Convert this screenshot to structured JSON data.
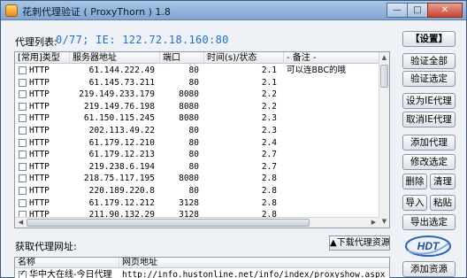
{
  "window": {
    "title": "花刺代理验证 ( ProxyThorn ) 1.8",
    "controls": {
      "minimize": "—",
      "maximize": "□",
      "close": "✕"
    }
  },
  "proxy_list": {
    "label": "代理列表:",
    "status": "0/77;   IE: 122.72.18.160:80",
    "columns": [
      "[常用]类型",
      "服务器地址",
      "端口",
      "时间(s)/状态",
      "- 备注 -"
    ],
    "rows": [
      {
        "type": "HTTP",
        "address": "61.144.222.49",
        "port": "80",
        "state": "2.1",
        "note": "可以连BBC的哦"
      },
      {
        "type": "HTTP",
        "address": "61.145.73.211",
        "port": "80",
        "state": "2.1",
        "note": ""
      },
      {
        "type": "HTTP",
        "address": "219.149.233.179",
        "port": "8080",
        "state": "2.2",
        "note": ""
      },
      {
        "type": "HTTP",
        "address": "219.149.76.198",
        "port": "8080",
        "state": "2.2",
        "note": ""
      },
      {
        "type": "HTTP",
        "address": "61.150.115.245",
        "port": "8080",
        "state": "2.3",
        "note": ""
      },
      {
        "type": "HTTP",
        "address": "202.113.49.22",
        "port": "80",
        "state": "2.3",
        "note": ""
      },
      {
        "type": "HTTP",
        "address": "61.179.12.210",
        "port": "80",
        "state": "2.4",
        "note": ""
      },
      {
        "type": "HTTP",
        "address": "61.179.12.213",
        "port": "80",
        "state": "2.7",
        "note": ""
      },
      {
        "type": "HTTP",
        "address": "219.238.6.194",
        "port": "80",
        "state": "2.7",
        "note": ""
      },
      {
        "type": "HTTP",
        "address": "218.75.117.195",
        "port": "8080",
        "state": "2.8",
        "note": ""
      },
      {
        "type": "HTTP",
        "address": "220.189.220.8",
        "port": "80",
        "state": "2.8",
        "note": ""
      },
      {
        "type": "HTTP",
        "address": "61.179.12.212",
        "port": "3128",
        "state": "2.8",
        "note": ""
      },
      {
        "type": "HTTP",
        "address": "211.90.132.29",
        "port": "3128",
        "state": "2.8",
        "note": ""
      }
    ]
  },
  "buttons": {
    "settings": "【设置】",
    "verify_all": "验证全部",
    "verify_selected": "验证选定",
    "set_ie_proxy": "设为IE代理",
    "cancel_ie_proxy": "取消IE代理",
    "add_proxy": "添加代理",
    "edit_selected": "修改选定",
    "delete": "删除",
    "clean": "清理",
    "import": "导入",
    "paste": "粘贴",
    "export_selected": "导出选定",
    "add_source": "添加资源"
  },
  "sources": {
    "label": "获取代理网址:",
    "download_link": "▲下载代理资源",
    "columns": [
      "名称",
      "网页地址"
    ],
    "rows": [
      {
        "name": "华中大在线-今日代理",
        "url": "http://info.hustonline.net/info/index/proxyshow.aspx",
        "checked": true
      }
    ]
  },
  "logo": {
    "text": "HDT"
  }
}
